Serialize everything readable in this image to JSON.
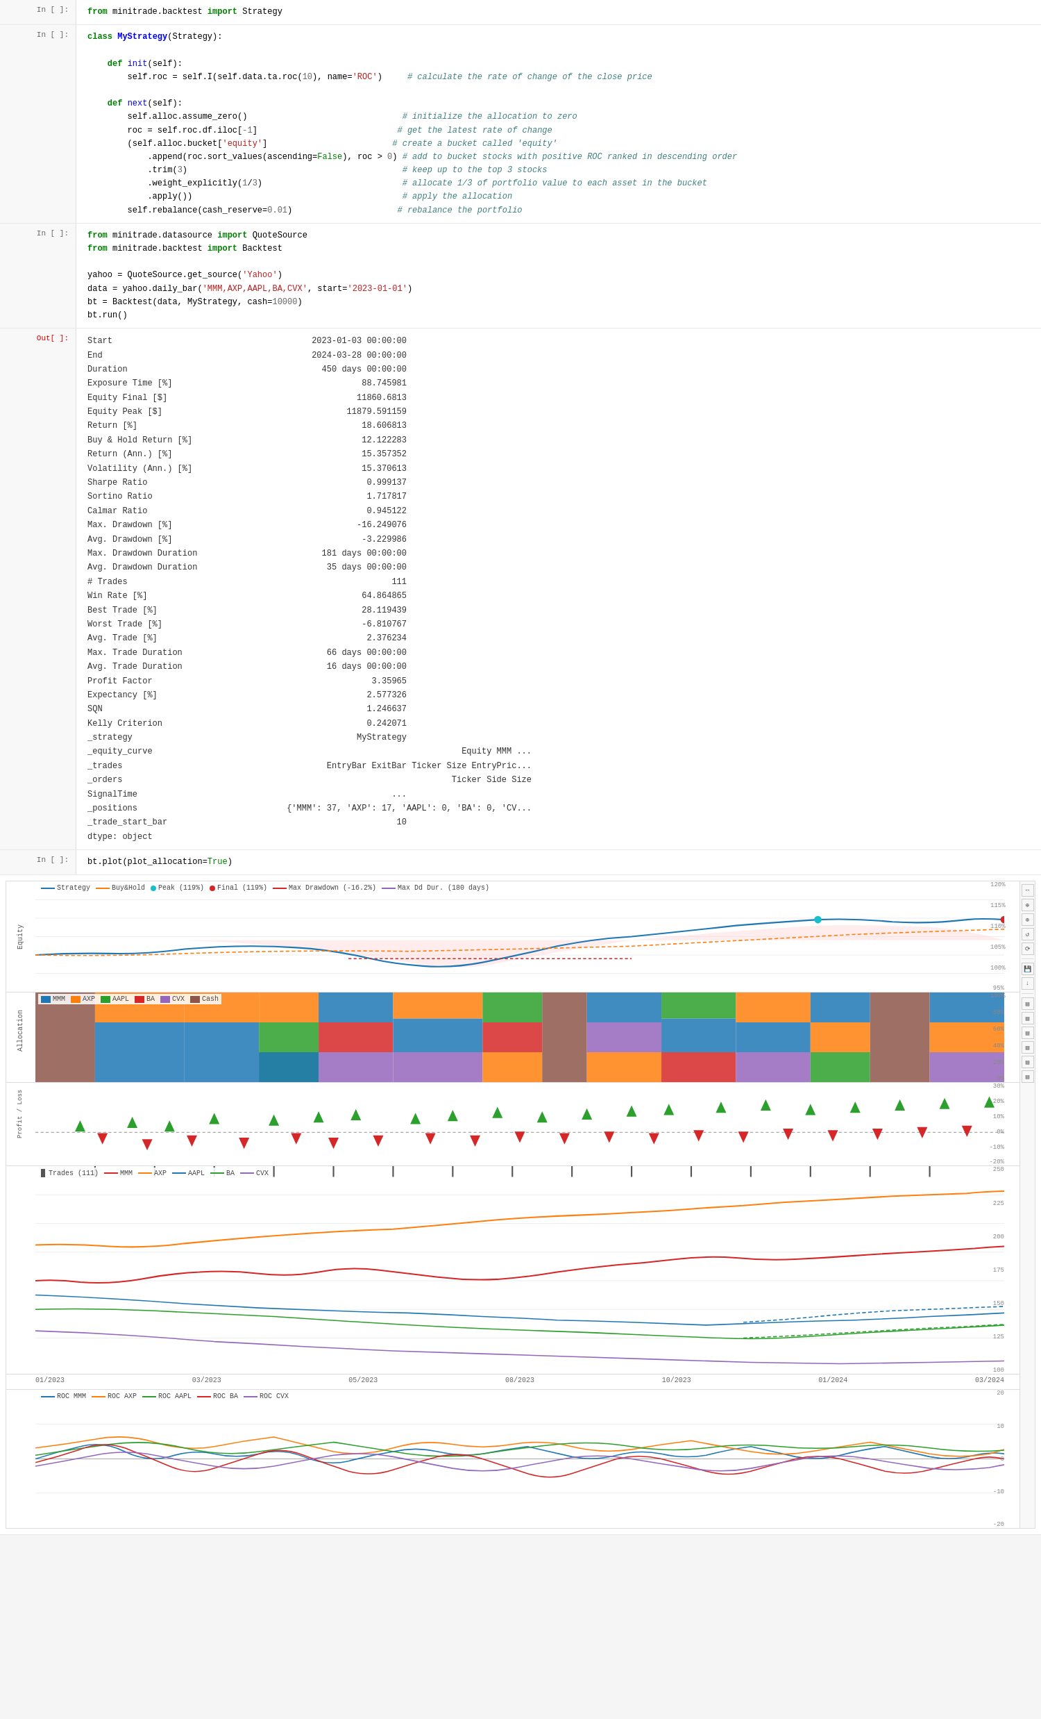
{
  "cells": [
    {
      "type": "in",
      "label": "In [ ]:",
      "code_lines": [
        {
          "text": "from minitrade.backtest import Strategy",
          "parts": [
            {
              "t": "kw",
              "v": "from"
            },
            {
              "t": "plain",
              "v": " minitrade.backtest "
            },
            {
              "t": "kw",
              "v": "import"
            },
            {
              "t": "plain",
              "v": " Strategy"
            }
          ]
        }
      ]
    },
    {
      "type": "in",
      "label": "In [ ]:",
      "code_html": "class_block"
    },
    {
      "type": "in",
      "label": "In [ ]:",
      "code_html": "import_block"
    },
    {
      "type": "out",
      "label": "Out[ ]:",
      "code_html": "output_block"
    },
    {
      "type": "in",
      "label": "In [ ]:",
      "code_html": "plot_block"
    },
    {
      "type": "chart",
      "label": ""
    }
  ],
  "output": {
    "rows": [
      {
        "label": "Start",
        "value": "2023-01-03 00:00:00"
      },
      {
        "label": "End",
        "value": "2024-03-28 00:00:00"
      },
      {
        "label": "Duration",
        "value": "450 days 00:00:00"
      },
      {
        "label": "Exposure Time [%]",
        "value": "88.745981"
      },
      {
        "label": "Equity Final [$]",
        "value": "11860.6813"
      },
      {
        "label": "Equity Peak [$]",
        "value": "11879.591159"
      },
      {
        "label": "Return [%]",
        "value": "18.606813"
      },
      {
        "label": "Buy & Hold Return [%]",
        "value": "12.122283"
      },
      {
        "label": "Return (Ann.) [%]",
        "value": "15.357352"
      },
      {
        "label": "Volatility (Ann.) [%]",
        "value": "15.370613"
      },
      {
        "label": "Sharpe Ratio",
        "value": "0.999137"
      },
      {
        "label": "Sortino Ratio",
        "value": "1.717817"
      },
      {
        "label": "Calmar Ratio",
        "value": "0.945122"
      },
      {
        "label": "Max. Drawdown [%]",
        "value": "-16.249076"
      },
      {
        "label": "Avg. Drawdown [%]",
        "value": "-3.229986"
      },
      {
        "label": "Max. Drawdown Duration",
        "value": "181 days 00:00:00"
      },
      {
        "label": "Avg. Drawdown Duration",
        "value": "35 days 00:00:00"
      },
      {
        "label": "# Trades",
        "value": "111"
      },
      {
        "label": "Win Rate [%]",
        "value": "64.864865"
      },
      {
        "label": "Best Trade [%]",
        "value": "28.119439"
      },
      {
        "label": "Worst Trade [%]",
        "value": "-6.810767"
      },
      {
        "label": "Avg. Trade [%]",
        "value": "2.376234"
      },
      {
        "label": "Max. Trade Duration",
        "value": "66 days 00:00:00"
      },
      {
        "label": "Avg. Trade Duration",
        "value": "16 days 00:00:00"
      },
      {
        "label": "Profit Factor",
        "value": "3.35965"
      },
      {
        "label": "Expectancy [%]",
        "value": "2.577326"
      },
      {
        "label": "SQN",
        "value": "1.246637"
      },
      {
        "label": "Kelly Criterion",
        "value": "0.242071"
      },
      {
        "label": "_strategy",
        "value": "MyStrategy"
      },
      {
        "label": "_equity_curve",
        "value": "                   Equity        MMM   ..."
      },
      {
        "label": "_trades",
        "value": "     EntryBar  ExitBar Ticker  Size   EntryPric..."
      },
      {
        "label": "_orders",
        "value": "         Ticker  Side  Size"
      },
      {
        "label": "SignalTime",
        "value": "   ..."
      },
      {
        "label": "_positions",
        "value": "  {'MMM': 37, 'AXP': 17, 'AAPL': 0, 'BA': 0, 'CV..."
      },
      {
        "label": "_trade_start_bar",
        "value": "10"
      },
      {
        "label": "dtype: object",
        "value": ""
      }
    ]
  },
  "chart": {
    "equity_panel": {
      "yrange": "95% - 120%",
      "legend": [
        {
          "label": "Strategy",
          "color": "#1f77b4",
          "type": "line"
        },
        {
          "label": "Buy&Hold",
          "color": "#ff7f0e",
          "type": "line"
        },
        {
          "label": "Peak (119%)",
          "color": "#17becf",
          "type": "dot"
        },
        {
          "label": "Final (119%)",
          "color": "#d62728",
          "type": "dot"
        },
        {
          "label": "Max Drawdown (-16.2%)",
          "color": "#d62728",
          "type": "dash"
        },
        {
          "label": "Max Dd Dur. (180 days)",
          "color": "#9467bd",
          "type": "dash"
        }
      ]
    },
    "allocation_panel": {
      "legend": [
        {
          "label": "MMM",
          "color": "#1f77b4"
        },
        {
          "label": "AXP",
          "color": "#ff7f0e"
        },
        {
          "label": "AAPL",
          "color": "#2ca02c"
        },
        {
          "label": "BA",
          "color": "#d62728"
        },
        {
          "label": "CVX",
          "color": "#9467bd"
        },
        {
          "label": "Cash",
          "color": "#8c564b"
        }
      ]
    },
    "pnl_panel": {
      "yrange": "-20% to 30%"
    },
    "price_panel": {
      "legend": [
        {
          "label": "Trades (111)",
          "color": "#333",
          "type": "bar"
        },
        {
          "label": "MMM",
          "color": "#d62728",
          "type": "line"
        },
        {
          "label": "AXP",
          "color": "#ff7f0e",
          "type": "line"
        },
        {
          "label": "AAPL",
          "color": "#1f77b4",
          "type": "line"
        },
        {
          "label": "BA",
          "color": "#2ca02c",
          "type": "line"
        },
        {
          "label": "CVX",
          "color": "#9467bd",
          "type": "line"
        }
      ],
      "yrange": "90 - 260"
    },
    "roc_panel": {
      "legend": [
        {
          "label": "ROC MMM",
          "color": "#1f77b4",
          "type": "line"
        },
        {
          "label": "ROC AXP",
          "color": "#ff7f0e",
          "type": "line"
        },
        {
          "label": "ROC AAPL",
          "color": "#2ca02c",
          "type": "line"
        },
        {
          "label": "ROC BA",
          "color": "#d62728",
          "type": "line"
        },
        {
          "label": "ROC CVX",
          "color": "#9467bd",
          "type": "line"
        }
      ],
      "yrange": "-20 to 20"
    },
    "x_labels": [
      "01/2023",
      "03/2023",
      "05/2023",
      "08/2023",
      "10/2023",
      "01/2024",
      "03/2024"
    ]
  },
  "toolbar_buttons": [
    "↔",
    "🔍",
    "∂P",
    "↺",
    "⟳",
    "⊡",
    "⊠",
    "↓",
    "☰",
    "☰",
    "⊞",
    "⊞",
    "⊞",
    "⊞",
    "⊞",
    "☰"
  ]
}
